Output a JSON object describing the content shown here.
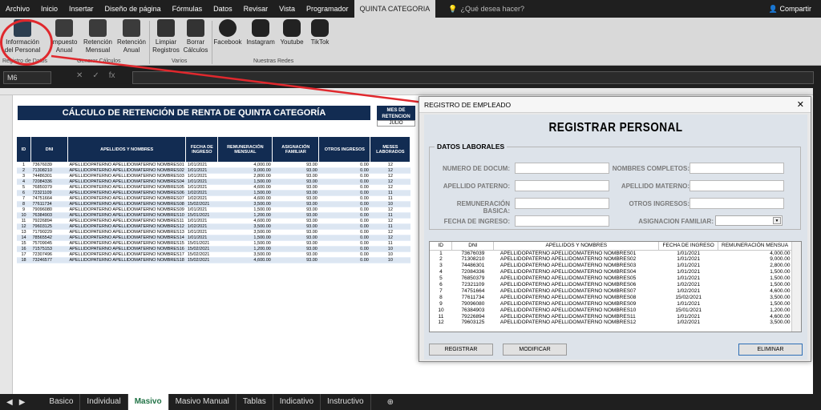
{
  "menu": {
    "tabs": [
      "Archivo",
      "Inicio",
      "Insertar",
      "Diseño de página",
      "Fórmulas",
      "Datos",
      "Revisar",
      "Vista",
      "Programador",
      "QUINTA CATEGORIA"
    ],
    "tell_me": "¿Qué desea hacer?",
    "share": "Compartir"
  },
  "ribbon": {
    "buttons": [
      "Información del Personal",
      "Impuesto Anual",
      "Retención Mensual",
      "Retención Anual",
      "Limpiar Registros",
      "Borrar Cálculos",
      "Facebook",
      "Instagram",
      "Youtube",
      "TikTok"
    ],
    "groups": [
      "Registro de Datos",
      "Generar Cálculos",
      "Varios",
      "Nuestras Redes"
    ]
  },
  "formula": {
    "namebox": "M6",
    "fx": "fx"
  },
  "sheet": {
    "title": "CÁLCULO DE RETENCIÓN DE RENTA DE QUINTA CATEGORÍA",
    "mes_label": "MES DE RETENCION",
    "mes_value": "JULIO",
    "headers": [
      "ID",
      "DNI",
      "APELLIDOS Y NOMBRES",
      "FECHA DE INGRESO",
      "REMUNERACIÓN MENSUAL",
      "ASIGNACIÓN FAMILIAR",
      "OTROS INGRESOS",
      "MESES LABORADOS"
    ],
    "rows": [
      [
        "1",
        "73676039",
        "APELLIDOPATERNO APELLIDOMATERNO NOMBRES01",
        "1/01/2021",
        "4,000.00",
        "93.00",
        "0.00",
        "12"
      ],
      [
        "2",
        "71308210",
        "APELLIDOPATERNO APELLIDOMATERNO NOMBRES02",
        "1/01/2021",
        "9,000.00",
        "93.00",
        "0.00",
        "12"
      ],
      [
        "3",
        "74486301",
        "APELLIDOPATERNO APELLIDOMATERNO NOMBRES03",
        "1/01/2021",
        "2,800.00",
        "93.00",
        "0.00",
        "12"
      ],
      [
        "4",
        "72084336",
        "APELLIDOPATERNO APELLIDOMATERNO NOMBRES04",
        "1/01/2021",
        "1,500.00",
        "93.00",
        "0.00",
        "12"
      ],
      [
        "5",
        "76850379",
        "APELLIDOPATERNO APELLIDOMATERNO NOMBRES05",
        "1/01/2021",
        "4,600.00",
        "93.00",
        "0.00",
        "12"
      ],
      [
        "6",
        "72321109",
        "APELLIDOPATERNO APELLIDOMATERNO NOMBRES06",
        "1/02/2021",
        "1,500.00",
        "93.00",
        "0.00",
        "11"
      ],
      [
        "7",
        "74751664",
        "APELLIDOPATERNO APELLIDOMATERNO NOMBRES07",
        "1/02/2021",
        "4,600.00",
        "93.00",
        "0.00",
        "11"
      ],
      [
        "8",
        "77611734",
        "APELLIDOPATERNO APELLIDOMATERNO NOMBRES08",
        "15/02/2021",
        "3,500.00",
        "93.00",
        "0.00",
        "10"
      ],
      [
        "9",
        "79096080",
        "APELLIDOPATERNO APELLIDOMATERNO NOMBRES09",
        "1/01/2021",
        "1,500.00",
        "93.00",
        "0.00",
        "12"
      ],
      [
        "10",
        "76384903",
        "APELLIDOPATERNO APELLIDOMATERNO NOMBRES10",
        "15/01/2021",
        "1,200.00",
        "93.00",
        "0.00",
        "11"
      ],
      [
        "11",
        "79226894",
        "APELLIDOPATERNO APELLIDOMATERNO NOMBRES11",
        "1/01/2021",
        "4,600.00",
        "93.00",
        "0.00",
        "12"
      ],
      [
        "12",
        "79603125",
        "APELLIDOPATERNO APELLIDOMATERNO NOMBRES12",
        "1/02/2021",
        "3,500.00",
        "93.00",
        "0.00",
        "11"
      ],
      [
        "13",
        "71790229",
        "APELLIDOPATERNO APELLIDOMATERNO NOMBRES13",
        "1/01/2021",
        "3,500.00",
        "93.00",
        "0.00",
        "12"
      ],
      [
        "14",
        "78565542",
        "APELLIDOPATERNO APELLIDOMATERNO NOMBRES14",
        "1/01/2021",
        "1,500.00",
        "93.00",
        "0.00",
        "12"
      ],
      [
        "15",
        "75709045",
        "APELLIDOPATERNO APELLIDOMATERNO NOMBRES15",
        "15/01/2021",
        "1,500.00",
        "93.00",
        "0.00",
        "11"
      ],
      [
        "16",
        "71575153",
        "APELLIDOPATERNO APELLIDOMATERNO NOMBRES16",
        "15/02/2021",
        "1,200.00",
        "93.00",
        "0.00",
        "10"
      ],
      [
        "17",
        "72307496",
        "APELLIDOPATERNO APELLIDOMATERNO NOMBRES17",
        "15/02/2021",
        "3,500.00",
        "93.00",
        "0.00",
        "10"
      ],
      [
        "18",
        "73246577",
        "APELLIDOPATERNO APELLIDOMATERNO NOMBRES18",
        "15/02/2021",
        "4,600.00",
        "93.00",
        "0.00",
        "10"
      ]
    ]
  },
  "sheet_tabs": [
    "Basico",
    "Individual",
    "Masivo",
    "Masivo Manual",
    "Tablas",
    "Indicativo",
    "Instructivo"
  ],
  "dialog": {
    "title": "REGISTRO DE EMPLEADO",
    "heading": "REGISTRAR PERSONAL",
    "section": "DATOS LABORALES",
    "fields": [
      "NUMERO DE DOCUM:",
      "NOMBRES COMPLETOS:",
      "APELLIDO PATERNO:",
      "APELLIDO MATERNO:",
      "REMUNERACIÓN BASICA:",
      "OTROS INGRESOS:",
      "FECHA DE INGRESO:",
      "ASIGNACION FAMILIAR:"
    ],
    "list_headers": [
      "ID",
      "DNI",
      "APELLIDOS Y NOMBRES",
      "FECHA DE INGRESO",
      "REMUNERACIÓN MENSUA"
    ],
    "list_rows": [
      [
        "1",
        "73676039",
        "APELLIDOPATERNO APELLIDOMATERNO NOMBRES01",
        "1/01/2021",
        "4,000.00"
      ],
      [
        "2",
        "71308210",
        "APELLIDOPATERNO APELLIDOMATERNO NOMBRES02",
        "1/01/2021",
        "9,000.00"
      ],
      [
        "3",
        "74486301",
        "APELLIDOPATERNO APELLIDOMATERNO NOMBRES03",
        "1/01/2021",
        "2,800.00"
      ],
      [
        "4",
        "72084336",
        "APELLIDOPATERNO APELLIDOMATERNO NOMBRES04",
        "1/01/2021",
        "1,500.00"
      ],
      [
        "5",
        "76850379",
        "APELLIDOPATERNO APELLIDOMATERNO NOMBRES05",
        "1/01/2021",
        "1,500.00"
      ],
      [
        "6",
        "72321109",
        "APELLIDOPATERNO APELLIDOMATERNO NOMBRES06",
        "1/02/2021",
        "1,500.00"
      ],
      [
        "7",
        "74751664",
        "APELLIDOPATERNO APELLIDOMATERNO NOMBRES07",
        "1/02/2021",
        "4,600.00"
      ],
      [
        "8",
        "77611734",
        "APELLIDOPATERNO APELLIDOMATERNO NOMBRES08",
        "15/02/2021",
        "3,500.00"
      ],
      [
        "9",
        "79096080",
        "APELLIDOPATERNO APELLIDOMATERNO NOMBRES09",
        "1/01/2021",
        "1,500.00"
      ],
      [
        "10",
        "76384903",
        "APELLIDOPATERNO APELLIDOMATERNO NOMBRES10",
        "15/01/2021",
        "1,200.00"
      ],
      [
        "11",
        "79226894",
        "APELLIDOPATERNO APELLIDOMATERNO NOMBRES11",
        "1/01/2021",
        "4,600.00"
      ],
      [
        "12",
        "79603125",
        "APELLIDOPATERNO APELLIDOMATERNO NOMBRES12",
        "1/02/2021",
        "3,500.00"
      ]
    ],
    "buttons": {
      "register": "REGISTRAR",
      "modify": "MODIFICAR",
      "delete": "ELIMINAR"
    }
  }
}
